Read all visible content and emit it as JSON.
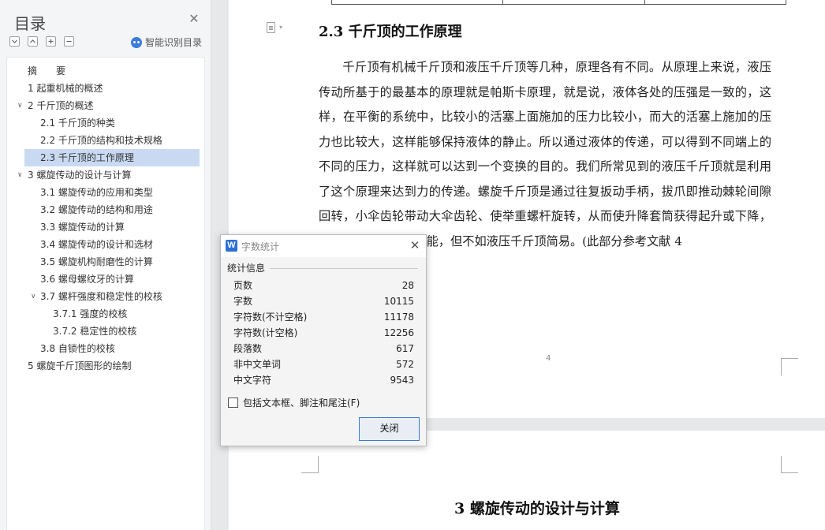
{
  "toc": {
    "title": "目录",
    "smart_label": "智能识别目录",
    "items": [
      {
        "label": "摘　　要"
      },
      {
        "label": "1  起重机械的概述"
      },
      {
        "label": "2  千斤顶的概述"
      },
      {
        "label": "2.1  千斤顶的种类"
      },
      {
        "label": "2.2  千斤顶的结构和技术规格"
      },
      {
        "label": "2.3 千斤顶的工作原理"
      },
      {
        "label": "3  螺旋传动的设计与计算"
      },
      {
        "label": "3.1 螺旋传动的应用和类型"
      },
      {
        "label": "3.2 螺旋传动的结构和用途"
      },
      {
        "label": "3.3 螺旋传动的计算"
      },
      {
        "label": "3.4 螺旋传动的设计和选材"
      },
      {
        "label": "3.5 螺旋机构耐磨性的计算"
      },
      {
        "label": "3.6 螺母螺纹牙的计算"
      },
      {
        "label": "3.7 螺杆强度和稳定性的校核"
      },
      {
        "label": "3.7.1 强度的校核"
      },
      {
        "label": "3.7.2 稳定性的校核"
      },
      {
        "label": "3.8 自锁性的校核"
      },
      {
        "label": "5  螺旋千斤顶图形的绘制"
      }
    ]
  },
  "document": {
    "heading": "2.3 千斤顶的工作原理",
    "paragraph": "千斤顶有机械千斤顶和液压千斤顶等几种，原理各有不同。从原理上来说，液压传动所基于的最基本的原理就是帕斯卡原理，就是说，液体各处的压强是一致的，这样，在平衡的系统中，比较小的活塞上面施加的压力比较小，而大的活塞上施加的压力也比较大，这样能够保持液体的静止。所以通过液体的传递，可以得到不同端上的不同的压力，这样就可以达到一个变换的目的。我们所常见到的液压千斤顶就是利用了这个原理来达到力的传递。螺旋千斤顶是通过往复扳动手柄，拔爪即推动棘轮间隙回转，小伞齿轮带动大伞齿轮、使举重螺杆旋转，从而使升降套筒获得起升或下降，而达到起重拉力的功能，但不如液压千斤顶简易。(此部分参考文献 4",
    "page_number": "4",
    "next_heading": "3  螺旋传动的设计与计算"
  },
  "dialog": {
    "title": "字数统计",
    "section_label": "统计信息",
    "stats": [
      {
        "label": "页数",
        "value": "28"
      },
      {
        "label": "字数",
        "value": "10115"
      },
      {
        "label": "字符数(不计空格)",
        "value": "11178"
      },
      {
        "label": "字符数(计空格)",
        "value": "12256"
      },
      {
        "label": "段落数",
        "value": "617"
      },
      {
        "label": "非中文单词",
        "value": "572"
      },
      {
        "label": "中文字符",
        "value": "9543"
      }
    ],
    "checkbox_label": "包括文本框、脚注和尾注(F)",
    "close_label": "关闭"
  },
  "colors": {
    "accent": "#3b78d8",
    "selection": "#c9d9f2"
  }
}
